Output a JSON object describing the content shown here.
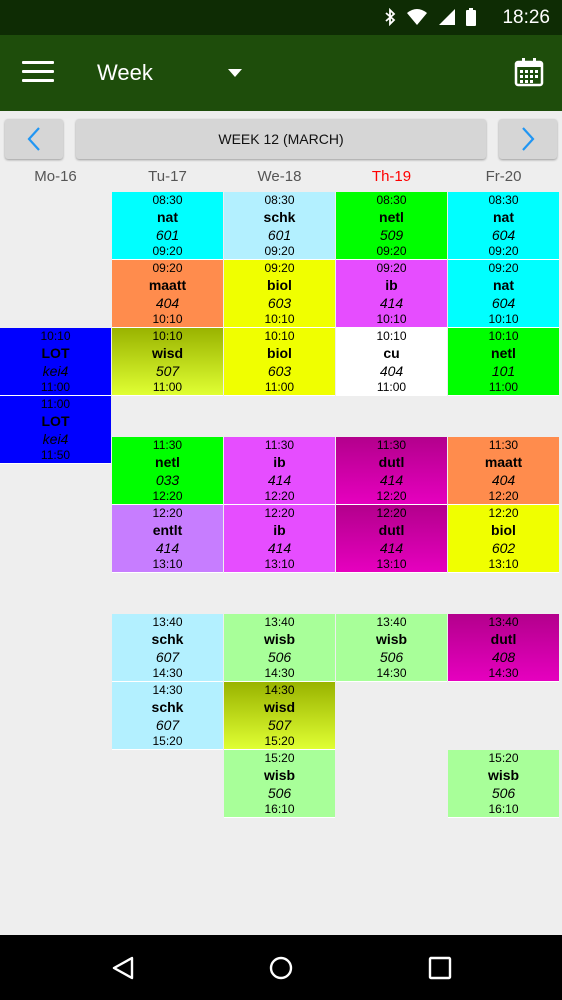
{
  "status": {
    "time": "18:26"
  },
  "app_bar": {
    "view": "Week"
  },
  "week_nav": {
    "label": "WEEK 12 (MARCH)"
  },
  "accent": "#1e4d0b",
  "today_color": "#ff0000",
  "days": [
    {
      "label": "Mo-16",
      "today": false
    },
    {
      "label": "Tu-17",
      "today": false
    },
    {
      "label": "We-18",
      "today": false
    },
    {
      "label": "Th-19",
      "today": true
    },
    {
      "label": "Fr-20",
      "today": false
    }
  ],
  "lessons": [
    {
      "day": 0,
      "start": "10:10",
      "end": "11:00",
      "subject": "LOT",
      "room": "kei4",
      "bg": "#0000ff",
      "fg": "#000000"
    },
    {
      "day": 0,
      "start": "11:00",
      "end": "11:50",
      "subject": "LOT",
      "room": "kei4",
      "bg": "#0000ff",
      "fg": "#000000"
    },
    {
      "day": 1,
      "start": "08:30",
      "end": "09:20",
      "subject": "nat",
      "room": "601",
      "bg": "#00ffff"
    },
    {
      "day": 1,
      "start": "09:20",
      "end": "10:10",
      "subject": "maatt",
      "room": "404",
      "bg": "#ff8c4d"
    },
    {
      "day": 1,
      "start": "10:10",
      "end": "11:00",
      "subject": "wisd",
      "room": "507",
      "bg": "linear-gradient(#99b300,#e0ff33)"
    },
    {
      "day": 1,
      "start": "11:30",
      "end": "12:20",
      "subject": "netl",
      "room": "033",
      "bg": "#00ff00"
    },
    {
      "day": 1,
      "start": "12:20",
      "end": "13:10",
      "subject": "entlt",
      "room": "414",
      "bg": "#c77dff"
    },
    {
      "day": 1,
      "start": "13:40",
      "end": "14:30",
      "subject": "schk",
      "room": "607",
      "bg": "#b3f0ff"
    },
    {
      "day": 1,
      "start": "14:30",
      "end": "15:20",
      "subject": "schk",
      "room": "607",
      "bg": "#b3f0ff"
    },
    {
      "day": 2,
      "start": "08:30",
      "end": "09:20",
      "subject": "schk",
      "room": "601",
      "bg": "#b3f0ff"
    },
    {
      "day": 2,
      "start": "09:20",
      "end": "10:10",
      "subject": "biol",
      "room": "603",
      "bg": "#f0ff00"
    },
    {
      "day": 2,
      "start": "10:10",
      "end": "11:00",
      "subject": "biol",
      "room": "603",
      "bg": "#f0ff00"
    },
    {
      "day": 2,
      "start": "11:30",
      "end": "12:20",
      "subject": "ib",
      "room": "414",
      "bg": "#e64dff"
    },
    {
      "day": 2,
      "start": "12:20",
      "end": "13:10",
      "subject": "ib",
      "room": "414",
      "bg": "#e64dff"
    },
    {
      "day": 2,
      "start": "13:40",
      "end": "14:30",
      "subject": "wisb",
      "room": "506",
      "bg": "#a8ff99"
    },
    {
      "day": 2,
      "start": "14:30",
      "end": "15:20",
      "subject": "wisd",
      "room": "507",
      "bg": "linear-gradient(#99b300,#e0ff33)"
    },
    {
      "day": 2,
      "start": "15:20",
      "end": "16:10",
      "subject": "wisb",
      "room": "506",
      "bg": "#a8ff99"
    },
    {
      "day": 3,
      "start": "08:30",
      "end": "09:20",
      "subject": "netl",
      "room": "509",
      "bg": "#00ff00"
    },
    {
      "day": 3,
      "start": "09:20",
      "end": "10:10",
      "subject": "ib",
      "room": "414",
      "bg": "#e64dff"
    },
    {
      "day": 3,
      "start": "10:10",
      "end": "11:00",
      "subject": "cu",
      "room": "404",
      "bg": "#ffffff"
    },
    {
      "day": 3,
      "start": "11:30",
      "end": "12:20",
      "subject": "dutl",
      "room": "414",
      "bg": "linear-gradient(#b3008c,#e600bf)"
    },
    {
      "day": 3,
      "start": "12:20",
      "end": "13:10",
      "subject": "dutl",
      "room": "414",
      "bg": "linear-gradient(#b3008c,#e600bf)"
    },
    {
      "day": 3,
      "start": "13:40",
      "end": "14:30",
      "subject": "wisb",
      "room": "506",
      "bg": "#a8ff99"
    },
    {
      "day": 4,
      "start": "08:30",
      "end": "09:20",
      "subject": "nat",
      "room": "604",
      "bg": "#00ffff"
    },
    {
      "day": 4,
      "start": "09:20",
      "end": "10:10",
      "subject": "nat",
      "room": "604",
      "bg": "#00ffff"
    },
    {
      "day": 4,
      "start": "10:10",
      "end": "11:00",
      "subject": "netl",
      "room": "101",
      "bg": "#00ff00"
    },
    {
      "day": 4,
      "start": "11:30",
      "end": "12:20",
      "subject": "maatt",
      "room": "404",
      "bg": "#ff8c4d"
    },
    {
      "day": 4,
      "start": "12:20",
      "end": "13:10",
      "subject": "biol",
      "room": "602",
      "bg": "#f0ff00"
    },
    {
      "day": 4,
      "start": "13:40",
      "end": "14:30",
      "subject": "dutl",
      "room": "408",
      "bg": "linear-gradient(#b3008c,#e600bf)"
    },
    {
      "day": 4,
      "start": "15:20",
      "end": "16:10",
      "subject": "wisb",
      "room": "506",
      "bg": "#a8ff99"
    }
  ]
}
